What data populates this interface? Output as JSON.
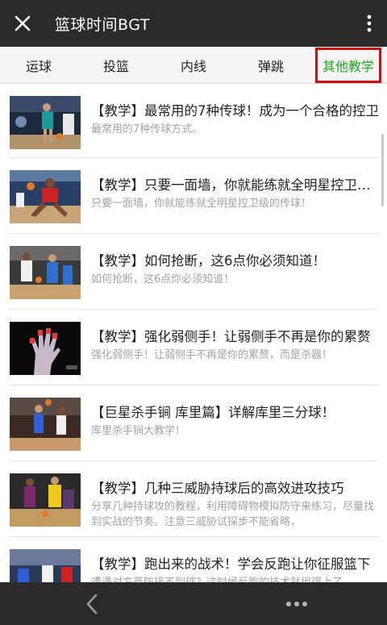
{
  "header": {
    "title": "篮球时间BGT",
    "close_icon": "close-icon",
    "more_icon": "more-vertical-icon"
  },
  "tabs": [
    {
      "label": "运球",
      "active": false
    },
    {
      "label": "投篮",
      "active": false
    },
    {
      "label": "内线",
      "active": false
    },
    {
      "label": "弹跳",
      "active": false
    },
    {
      "label": "其他教学",
      "active": true
    }
  ],
  "colors": {
    "active_tab": "#1aad19",
    "highlight_box": "#cc1111",
    "bar": "#2b2b2b"
  },
  "articles": [
    {
      "title": "【教学】最常用的7种传球！成为一个合格的控卫",
      "desc": "最常用的7种传球方式。"
    },
    {
      "title": "【教学】只要一面墙，你就能练就全明星控卫级的传球",
      "desc": "只要一面墙，你就能练就全明星控卫级的传球！"
    },
    {
      "title": "【教学】如何抢断，这6点你必须知道！",
      "desc": "如何抢断，这6点你必须知道！"
    },
    {
      "title": "【教学】强化弱侧手！让弱侧手不再是你的累赘",
      "desc": "强化弱侧手！让弱侧手不再是你的累赘，而是杀器！"
    },
    {
      "title": "【巨星杀手锏 库里篇】详解库里三分球！",
      "desc": "库里杀手锏大教学！"
    },
    {
      "title": "【教学】几种三威胁持球后的高效进攻技巧",
      "desc": "分享几种持球攻的教程，利用障碍物模拟防守来练习，尽量找到实战的节奏。注意三威胁试探步不能省略，"
    },
    {
      "title": "【教学】跑出来的战术！学会反跑让你征服篮下",
      "desc": "遭遇对方严防接不到球？这时候反跑的技术就用得上了"
    }
  ],
  "bottom_bar": {
    "back_icon": "chevron-left-icon",
    "menu_icon": "more-horizontal-icon"
  }
}
